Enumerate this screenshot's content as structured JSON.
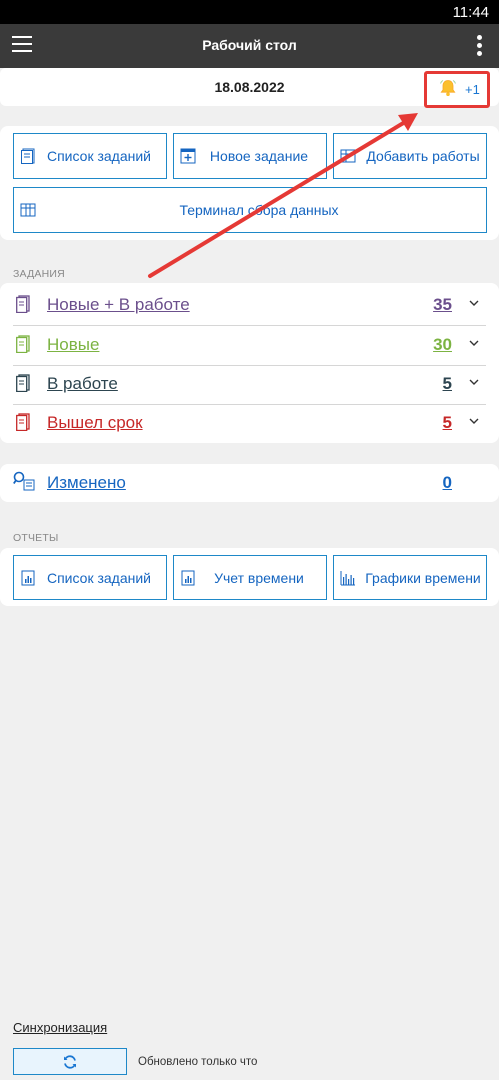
{
  "status_bar": {
    "time": "11:44"
  },
  "toolbar": {
    "title": "Рабочий стол"
  },
  "date_bar": {
    "date": "18.08.2022",
    "notifications": "+1"
  },
  "actions": {
    "task_list": "Список заданий",
    "new_task": "Новое задание",
    "add_work": "Добавить работы",
    "terminal": "Терминал сбора данных"
  },
  "tasks": {
    "section_label": "ЗАДАНИЯ",
    "rows": [
      {
        "label": "Новые + В работе",
        "count": "35",
        "color": "#6b4f8c"
      },
      {
        "label": "Новые",
        "count": "30",
        "color": "#7cb342"
      },
      {
        "label": "В работе",
        "count": "5",
        "color": "#2d4550"
      },
      {
        "label": "Вышел срок",
        "count": "5",
        "color": "#c62828"
      }
    ]
  },
  "changed": {
    "label": "Изменено",
    "count": "0",
    "color": "#1565c0"
  },
  "reports": {
    "section_label": "ОТЧЕТЫ",
    "task_list": "Список заданий",
    "time_tracking": "Учет времени",
    "time_charts": "Графики времени"
  },
  "sync": {
    "label": "Синхронизация",
    "status": "Обновлено только что"
  },
  "colors": {
    "accent": "#1e88c8",
    "annotation": "#e53935",
    "toolbar": "#3a3a3a"
  }
}
